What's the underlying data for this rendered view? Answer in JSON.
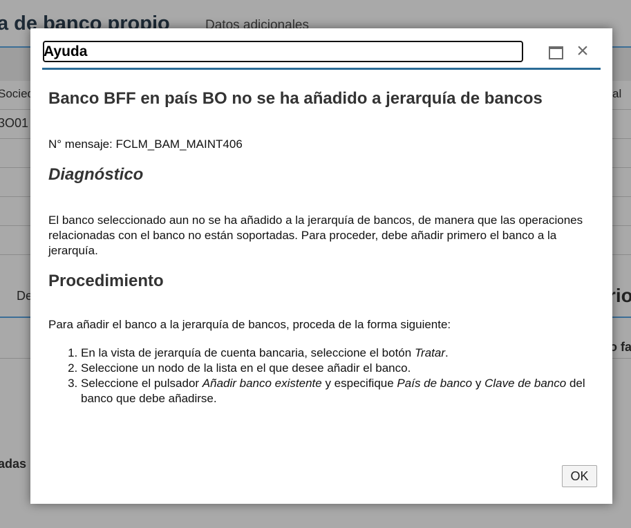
{
  "background": {
    "page_title": "a de banco propio",
    "tab_label": "Datos adicionales",
    "col_header_left": "Socied",
    "col_header_right": "al",
    "row_value": "3O01",
    "section_left": "De",
    "section_right": "rio",
    "label_right": "o fa",
    "label_left": "adas"
  },
  "dialog": {
    "title": "Ayuda",
    "maximize_icon": "maximize-icon",
    "close_icon": "close-icon",
    "message_title": "Banco BFF en país BO no se ha añadido a jerarquía de bancos",
    "message_number": "N° mensaje: FCLM_BAM_MAINT406",
    "diagnosis_heading": "Diagnóstico",
    "diagnosis_text": "El banco seleccionado aun no se ha añadido a la jerarquía de bancos, de manera que las operaciones relacionadas con el banco no están soportadas. Para proceder, debe añadir primero el banco a la jerarquía.",
    "procedure_heading": "Procedimiento",
    "procedure_intro": "Para añadir el banco a la jerarquía de bancos, proceda de la forma siguiente:",
    "steps": [
      {
        "a": "En la vista de jerarquía de cuenta bancaria, seleccione el botón ",
        "b": "Tratar",
        "c": "."
      },
      {
        "a": "Seleccione un nodo de la lista en el que desee añadir el banco."
      },
      {
        "a": "Seleccione el pulsador ",
        "b": "Añadir banco existente",
        "c": " y especifique ",
        "d": "País de banco",
        "e": " y ",
        "f": "Clave de banco",
        "g": " del banco que debe añadirse."
      }
    ],
    "ok_label": "OK"
  },
  "colors": {
    "accent_rule": "#2a6b95",
    "overlay": "#a9a9a9"
  }
}
